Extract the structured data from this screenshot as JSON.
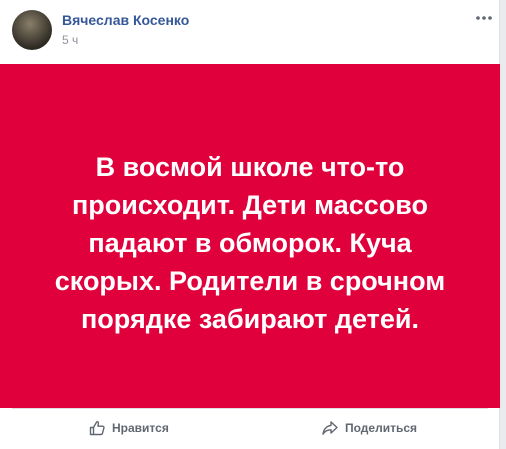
{
  "post": {
    "author": "Вячеслав Косенко",
    "time": "5 ч",
    "more_icon": "more-dots-icon",
    "text": "В восмой школе что-то происходит. Дети массово падают в обморок. Куча скорых. Родители в срочном порядке забирают детей.",
    "background_color": "#e0003c"
  },
  "actions": {
    "like_label": "Нравится",
    "like_icon": "thumbs-up-icon",
    "share_label": "Поделиться",
    "share_icon": "share-arrow-icon"
  }
}
